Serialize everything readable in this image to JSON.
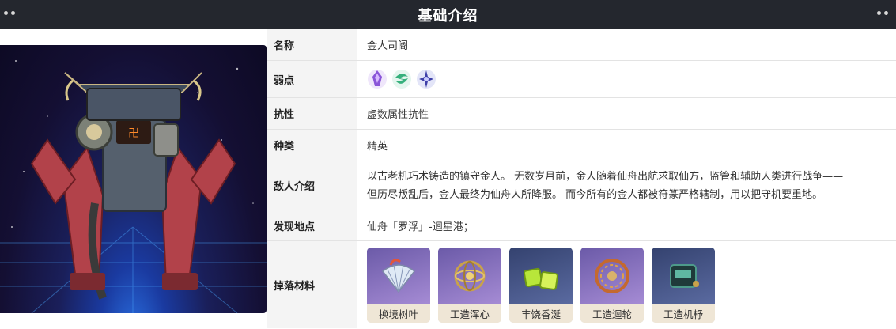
{
  "header": {
    "title": "基础介绍"
  },
  "rows": {
    "name": {
      "label": "名称",
      "value": "金人司阍"
    },
    "weakness": {
      "label": "弱点",
      "icons": [
        "quantum-icon",
        "wind-icon",
        "imaginary-icon"
      ]
    },
    "resistance": {
      "label": "抗性",
      "value": "虚数属性抗性"
    },
    "type": {
      "label": "种类",
      "value": "精英"
    },
    "intro": {
      "label": "敌人介绍",
      "line1": "以古老机巧术铸造的镇守金人。 无数岁月前，金人随着仙舟出航求取仙方，监管和辅助人类进行战争——",
      "line2": "但历尽叛乱后，金人最终为仙舟人所降服。 而今所有的金人都被符篆严格辖制，用以把守机要重地。"
    },
    "location": {
      "label": "发现地点",
      "value": "仙舟「罗浮」-迴星港；"
    },
    "drops": {
      "label": "掉落材料",
      "items": [
        {
          "name": "换境树叶",
          "icon": "fan-leaf-icon"
        },
        {
          "name": "工造浑心",
          "icon": "armillary-icon"
        },
        {
          "name": "丰饶香涎",
          "icon": "green-crystal-icon"
        },
        {
          "name": "工造迴轮",
          "icon": "gear-wheel-icon"
        },
        {
          "name": "工造机杼",
          "icon": "machine-core-icon"
        }
      ]
    }
  }
}
